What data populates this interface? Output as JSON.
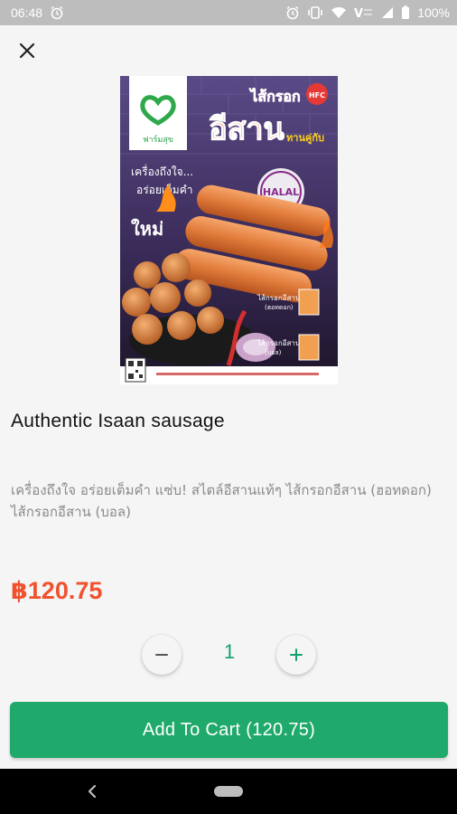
{
  "status_bar": {
    "time": "06:48",
    "battery_percent": "100%",
    "icons": [
      "alarm-icon",
      "alarm-icon",
      "vibrate-icon",
      "wifi-icon",
      "volte-icon",
      "signal-icon",
      "battery-icon"
    ]
  },
  "header": {
    "close_icon": "close-icon"
  },
  "product": {
    "image": {
      "brand_name": "ฟาร์มสุข",
      "headline_top": "ไส้กรอก",
      "headline_main": "อีสาน",
      "headline_sub": "ทานคู่กับ",
      "badge": "HFC",
      "tagline_1": "เครื่องถึงใจ...",
      "tagline_2": "อร่อยเต็มคำ",
      "new_label": "ใหม่",
      "halal_label": "HALAL",
      "variant_1": "ไส้กรอกอีสาน",
      "variant_1_sub": "(ฮอทดอก)",
      "variant_2": "ไส้กรอกอีสาน",
      "variant_2_sub": "(บอล)"
    },
    "title": "Authentic Isaan sausage",
    "description": "เครื่องถึงใจ อร่อยเต็มคำ แซ่บ! สไตล์อีสานแท้ๆ ไส้กรอกอีสาน (ฮอทดอก) ไส้กรอกอีสาน (บอล)",
    "price": "฿120.75"
  },
  "quantity": {
    "value": "1",
    "minus_label": "−",
    "plus_label": "+"
  },
  "cart_button": {
    "label": "Add To Cart (120.75)"
  },
  "colors": {
    "accent": "#1faa6b",
    "price": "#f0522d",
    "status_bar": "#bdbdbd",
    "background": "#f5f5f5"
  }
}
